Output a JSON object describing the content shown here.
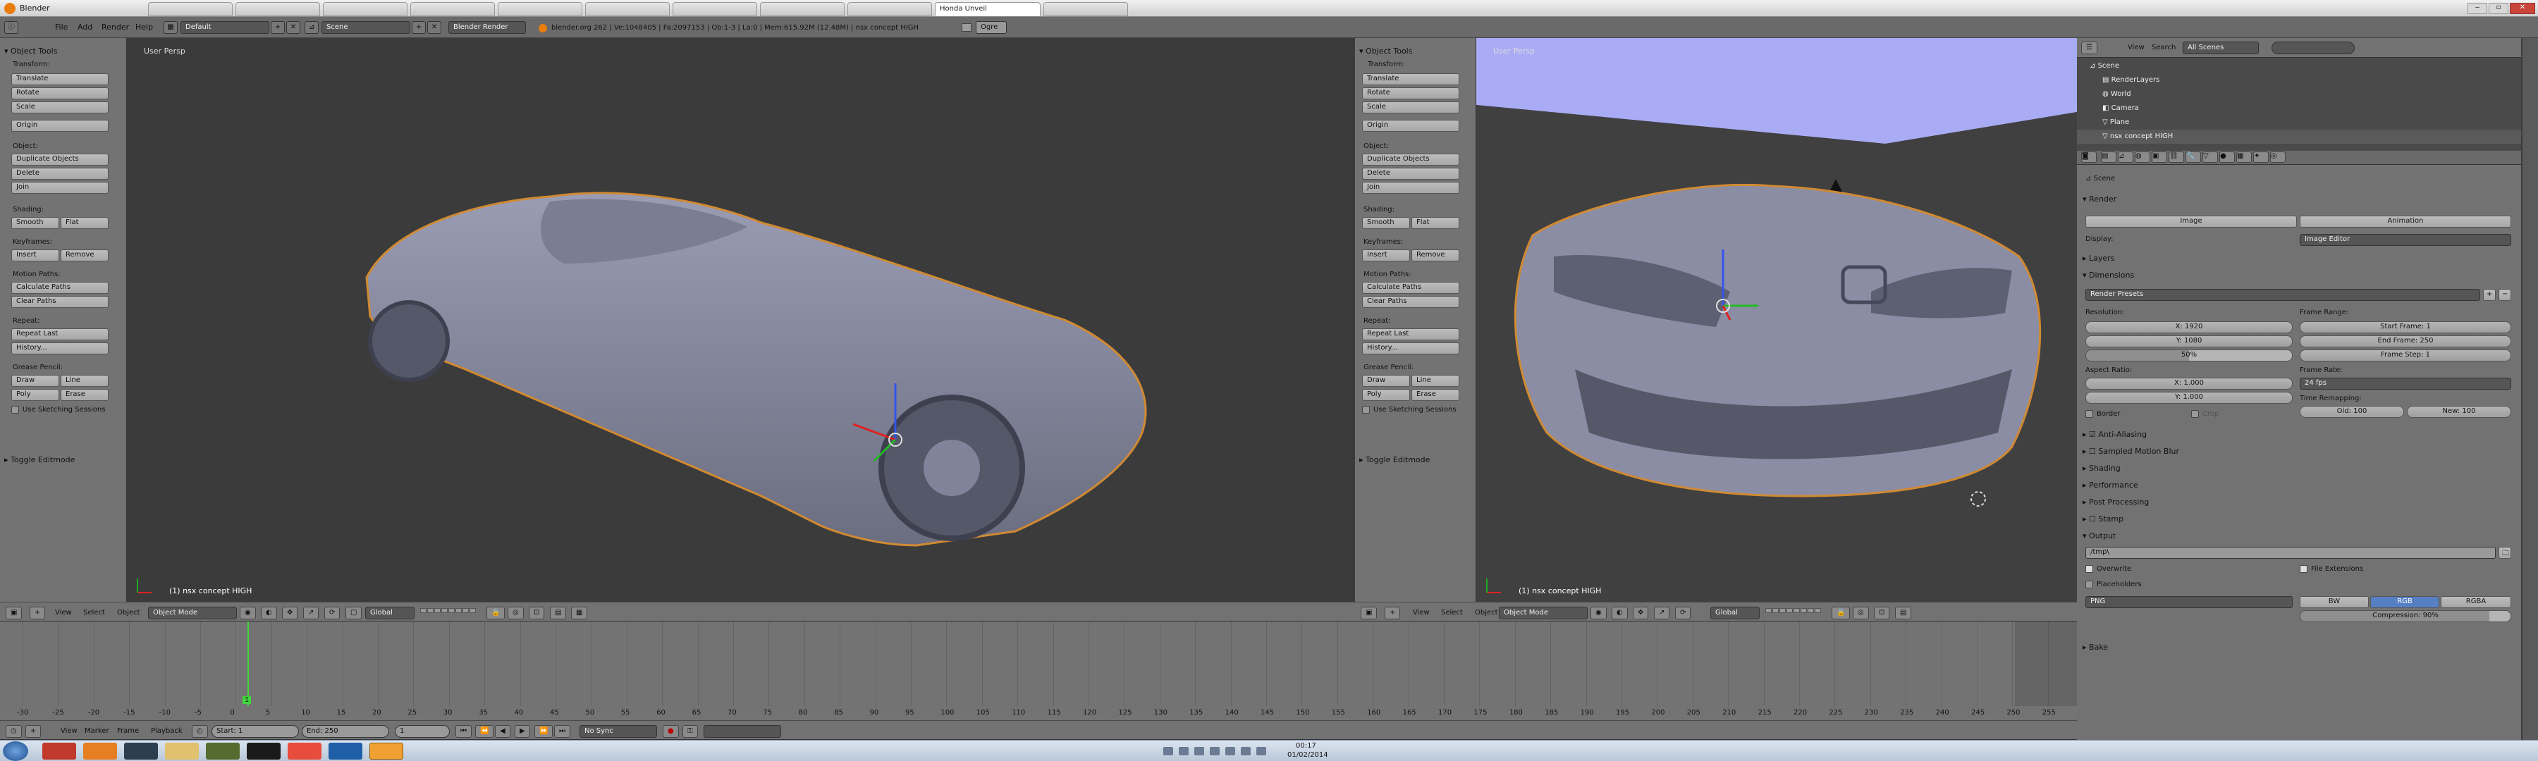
{
  "window": {
    "title": "Blender",
    "browser_tabs": [
      "",
      "",
      "",
      "",
      "",
      "",
      "",
      "",
      "",
      "",
      "Honda Unveil",
      ""
    ]
  },
  "info_bar": {
    "menus": [
      "File",
      "Add",
      "Render",
      "Help"
    ],
    "screen_layout": "Default",
    "scene": "Scene",
    "render_engine": "Blender Render",
    "stats": "blender.org 262 | Ve:1048405 | Fa:2097153 | Ob:1-3 | La:0 | Mem:615.92M (12.48M) | nsx concept HIGH",
    "ogre_button": "Ogre"
  },
  "tool_shelf": {
    "title": "Object Tools",
    "transform_label": "Transform:",
    "translate": "Translate",
    "rotate": "Rotate",
    "scale": "Scale",
    "origin": "Origin",
    "object_label": "Object:",
    "duplicate": "Duplicate Objects",
    "delete": "Delete",
    "join": "Join",
    "shading_label": "Shading:",
    "smooth": "Smooth",
    "flat": "Flat",
    "keyframes_label": "Keyframes:",
    "insert": "Insert",
    "remove": "Remove",
    "motion_paths_label": "Motion Paths:",
    "calculate_paths": "Calculate Paths",
    "clear_paths": "Clear Paths",
    "repeat_label": "Repeat:",
    "repeat_last": "Repeat Last",
    "history": "History...",
    "grease_pencil_label": "Grease Pencil:",
    "draw": "Draw",
    "line": "Line",
    "poly": "Poly",
    "erase": "Erase",
    "use_sketching": "Use Sketching Sessions",
    "toggle_editmode": "Toggle Editmode"
  },
  "viewport_left": {
    "label": "User Persp",
    "object_label": "(1) nsx concept HIGH"
  },
  "viewport_right": {
    "label": "User Persp",
    "object_label": "(1) nsx concept HIGH"
  },
  "viewport_header": {
    "menus": [
      "View",
      "Select",
      "Object"
    ],
    "mode": "Object Mode",
    "orientation": "Global"
  },
  "outliner": {
    "menus": [
      "View",
      "Search"
    ],
    "scene_filter": "All Scenes",
    "rows": [
      "Scene",
      "RenderLayers",
      "World",
      "Camera",
      "Plane",
      "nsx concept HIGH"
    ]
  },
  "properties": {
    "breadcrumb": "Scene",
    "render_section": "Render",
    "image_button": "Image",
    "animation_button": "Animation",
    "display_label": "Display:",
    "display_value": "Image Editor",
    "layers_section": "Layers",
    "dimensions_section": "Dimensions",
    "render_presets": "Render Presets",
    "resolution_label": "Resolution:",
    "res_x": "X: 1920",
    "res_y": "Y: 1080",
    "res_pct": "50%",
    "frame_range_label": "Frame Range:",
    "start_frame": "Start Frame: 1",
    "end_frame": "End Frame: 250",
    "frame_step": "Frame Step: 1",
    "aspect_ratio_label": "Aspect Ratio:",
    "aspect_x": "X: 1.000",
    "aspect_y": "Y: 1.000",
    "frame_rate_label": "Frame Rate:",
    "frame_rate": "24 fps",
    "time_remapping_label": "Time Remapping:",
    "time_old": "Old: 100",
    "time_new": "New: 100",
    "border": "Border",
    "crop": "Crop",
    "anti_aliasing": "Anti-Aliasing",
    "sampled_motion_blur": "Sampled Motion Blur",
    "shading": "Shading",
    "performance": "Performance",
    "post_processing": "Post Processing",
    "stamp": "Stamp",
    "output": "Output",
    "output_path": "/tmp\\",
    "overwrite": "Overwrite",
    "file_extensions": "File Extensions",
    "placeholders": "Placeholders",
    "file_format": "PNG",
    "bw": "BW",
    "rgb": "RGB",
    "rgba": "RGBA",
    "compression": "Compression: 90%",
    "bake": "Bake"
  },
  "timeline": {
    "ticks": [
      "-30",
      "-25",
      "-20",
      "-15",
      "-10",
      "-5",
      "0",
      "5",
      "10",
      "15",
      "20",
      "25",
      "30",
      "35",
      "40",
      "45",
      "50",
      "55",
      "60",
      "65",
      "70",
      "75",
      "80",
      "85",
      "90",
      "95",
      "100",
      "105",
      "110",
      "115",
      "120",
      "125",
      "130",
      "135",
      "140",
      "145",
      "150",
      "155",
      "160",
      "165",
      "170",
      "175",
      "180",
      "185",
      "190",
      "195",
      "200",
      "205",
      "210",
      "215",
      "220",
      "225",
      "230",
      "235",
      "240",
      "245",
      "250",
      "255"
    ],
    "current_frame": "1",
    "start": "Start: 1",
    "end": "End: 250",
    "frame": "1",
    "sync": "No Sync",
    "menus": [
      "View",
      "Marker",
      "Frame",
      "Playback"
    ]
  },
  "taskbar": {
    "time": "00:17",
    "date": "01/02/2014"
  },
  "colors": {
    "accent": "#5680c2",
    "viewport_bg": "#3b3b3b",
    "sky": "#a9abf4"
  }
}
